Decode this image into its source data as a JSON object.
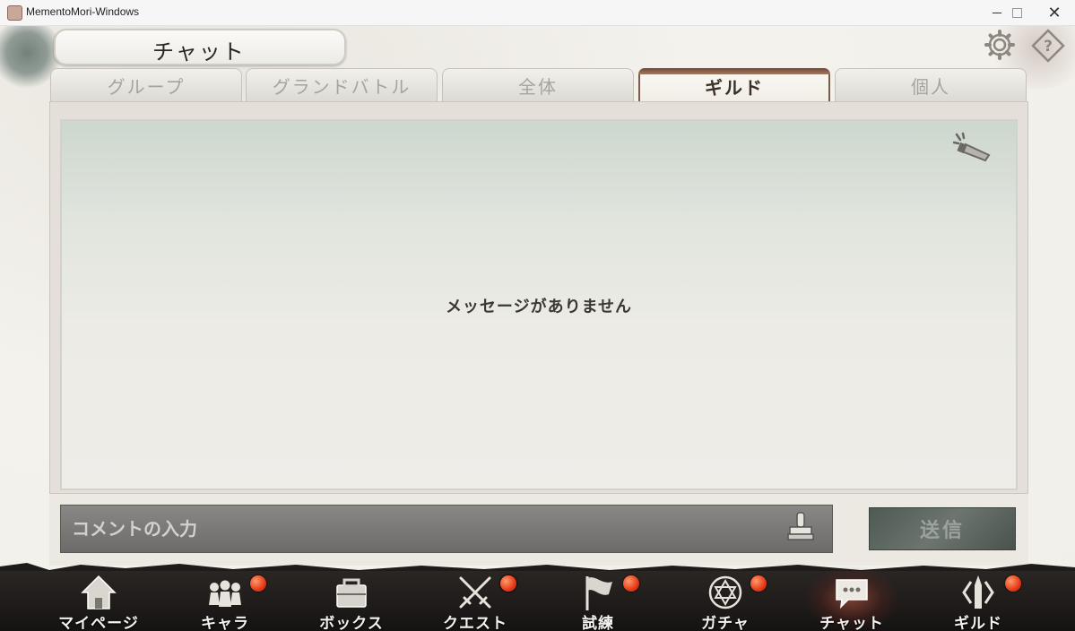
{
  "window": {
    "title": "MementoMori-Windows"
  },
  "header": {
    "title": "チャット"
  },
  "tabs": [
    {
      "label": "グループ"
    },
    {
      "label": "グランドバトル"
    },
    {
      "label": "全体"
    },
    {
      "label": "ギルド",
      "active": true
    },
    {
      "label": "個人"
    }
  ],
  "chat": {
    "empty_message": "メッセージがありません"
  },
  "input": {
    "placeholder": "コメントの入力",
    "value": ""
  },
  "send_button": {
    "label": "送信"
  },
  "nav": [
    {
      "label": "マイページ",
      "icon": "home-icon",
      "badge": false
    },
    {
      "label": "キャラ",
      "icon": "characters-icon",
      "badge": true
    },
    {
      "label": "ボックス",
      "icon": "box-icon",
      "badge": true
    },
    {
      "label": "クエスト",
      "icon": "crossed-swords-icon",
      "badge": true
    },
    {
      "label": "試練",
      "icon": "flag-icon",
      "badge": true
    },
    {
      "label": "ガチャ",
      "icon": "gacha-icon",
      "badge": true
    },
    {
      "label": "チャット",
      "icon": "chat-icon",
      "badge": false,
      "active": true
    },
    {
      "label": "ギルド",
      "icon": "guild-icon",
      "badge": true
    }
  ],
  "colors": {
    "badge": "#e63a1a",
    "active_tab_border": "#7b5a47",
    "nav_background": "#1c1a19"
  }
}
